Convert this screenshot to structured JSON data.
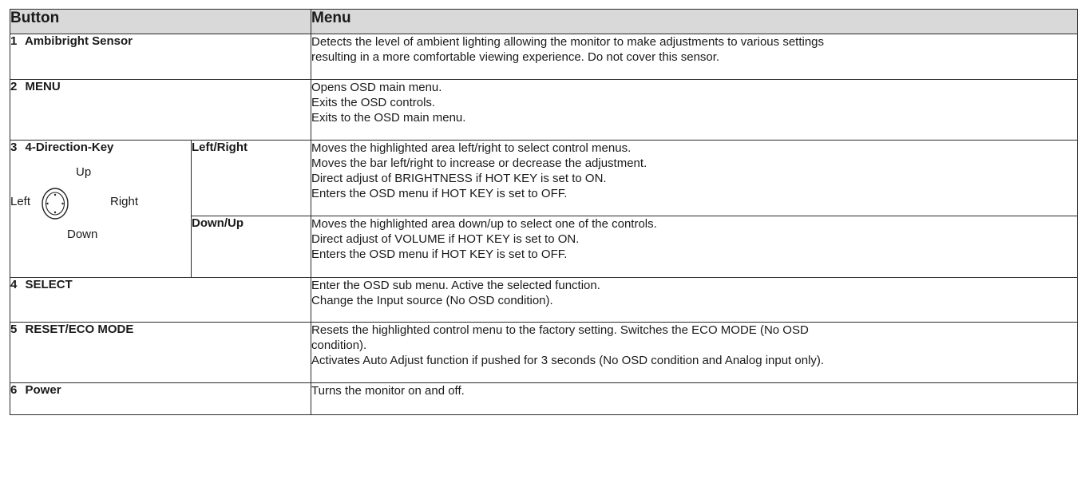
{
  "table": {
    "headers": {
      "button": "Button",
      "menu": "Menu"
    },
    "rows": [
      {
        "num": "1",
        "button": "Ambibright Sensor",
        "lines": [
          "Detects the level of ambient lighting allowing the monitor to make adjustments to various settings",
          "resulting in a more comfortable viewing experience. Do not cover this sensor."
        ]
      },
      {
        "num": "2",
        "button": "MENU",
        "lines": [
          "Opens OSD main menu.",
          "Exits the OSD controls.",
          "Exits to the OSD main menu."
        ]
      },
      {
        "num": "3",
        "button": "4-Direction-Key",
        "diagram": {
          "up": "Up",
          "left": "Left",
          "right": "Right",
          "down": "Down"
        },
        "subrows": [
          {
            "label": "Left/Right",
            "lines": [
              "Moves the highlighted area left/right to select control menus.",
              "Moves the bar left/right to increase or decrease the adjustment.",
              "Direct adjust of BRIGHTNESS if HOT KEY is set to ON.",
              "Enters the OSD menu if HOT KEY is set to OFF."
            ]
          },
          {
            "label": "Down/Up",
            "lines": [
              "Moves the highlighted area down/up to select one of the controls.",
              "Direct adjust of VOLUME if HOT KEY is set to ON.",
              "Enters the OSD menu if HOT KEY is set to OFF."
            ]
          }
        ]
      },
      {
        "num": "4",
        "button": "SELECT",
        "lines": [
          "Enter the OSD sub menu. Active the selected function.",
          "Change the Input source (No OSD condition)."
        ]
      },
      {
        "num": "5",
        "button": "RESET/ECO MODE",
        "lines": [
          "Resets the highlighted control menu to the factory setting. Switches the ECO MODE (No OSD",
          "condition).",
          "Activates Auto Adjust function if pushed for 3 seconds (No OSD condition and Analog input only)."
        ]
      },
      {
        "num": "6",
        "button": "Power",
        "lines": [
          "Turns the monitor on and off."
        ]
      }
    ]
  }
}
